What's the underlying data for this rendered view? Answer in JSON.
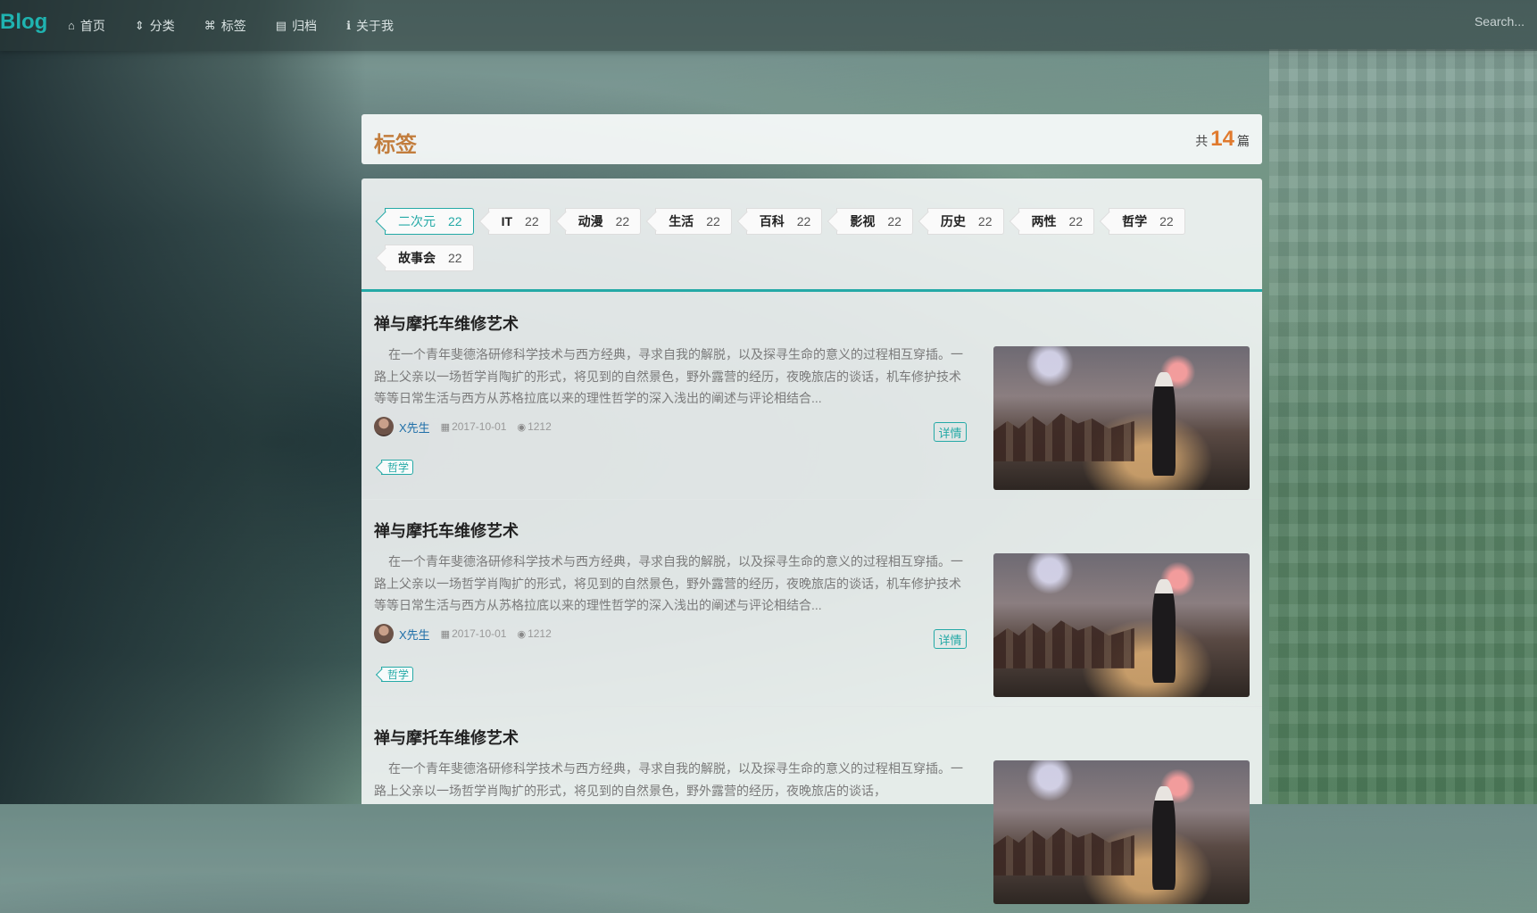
{
  "navbar": {
    "brand": "Blog",
    "items": [
      {
        "label": "首页",
        "icon": "home-icon",
        "glyph": "⌂"
      },
      {
        "label": "分类",
        "icon": "sort-icon",
        "glyph": "⇕"
      },
      {
        "label": "标签",
        "icon": "tags-icon",
        "glyph": "⌘"
      },
      {
        "label": "归档",
        "icon": "archive-icon",
        "glyph": "▤"
      },
      {
        "label": "关于我",
        "icon": "info-icon",
        "glyph": "ℹ"
      }
    ],
    "search_placeholder": "Search..."
  },
  "header": {
    "title": "标签",
    "count_prefix": "共",
    "count": "14",
    "count_suffix": "篇"
  },
  "tags": [
    {
      "name": "二次元",
      "count": "22",
      "active": true
    },
    {
      "name": "IT",
      "count": "22"
    },
    {
      "name": "动漫",
      "count": "22"
    },
    {
      "name": "生活",
      "count": "22"
    },
    {
      "name": "百科",
      "count": "22"
    },
    {
      "name": "影视",
      "count": "22"
    },
    {
      "name": "历史",
      "count": "22"
    },
    {
      "name": "两性",
      "count": "22"
    },
    {
      "name": "哲学",
      "count": "22"
    },
    {
      "name": "故事会",
      "count": "22"
    }
  ],
  "articles": [
    {
      "title": "禅与摩托车维修艺术",
      "summary": "在一个青年斐德洛研修科学技术与西方经典，寻求自我的解脱，以及探寻生命的意义的过程相互穿插。一路上父亲以一场哲学肖陶扩的形式，将见到的自然景色，野外露营的经历，夜晚旅店的谈话，机车修护技术等等日常生活与西方从苏格拉底以来的理性哲学的深入浅出的阐述与评论相结合...",
      "author": "X先生",
      "date": "2017-10-01",
      "views": "1212",
      "detail_label": "详情",
      "tag": "哲学"
    },
    {
      "title": "禅与摩托车维修艺术",
      "summary": "在一个青年斐德洛研修科学技术与西方经典，寻求自我的解脱，以及探寻生命的意义的过程相互穿插。一路上父亲以一场哲学肖陶扩的形式，将见到的自然景色，野外露营的经历，夜晚旅店的谈话，机车修护技术等等日常生活与西方从苏格拉底以来的理性哲学的深入浅出的阐述与评论相结合...",
      "author": "X先生",
      "date": "2017-10-01",
      "views": "1212",
      "detail_label": "详情",
      "tag": "哲学"
    },
    {
      "title": "禅与摩托车维修艺术",
      "summary": "在一个青年斐德洛研修科学技术与西方经典，寻求自我的解脱，以及探寻生命的意义的过程相互穿插。一路上父亲以一场哲学肖陶扩的形式，将见到的自然景色，野外露营的经历，夜晚旅店的谈话，",
      "author": "",
      "date": "",
      "views": "",
      "detail_label": "",
      "tag": ""
    }
  ],
  "colors": {
    "accent": "#24a9a6",
    "title_orange": "#c27d3d",
    "count_orange": "#e07a2e",
    "author_blue": "#1f6fa8"
  }
}
